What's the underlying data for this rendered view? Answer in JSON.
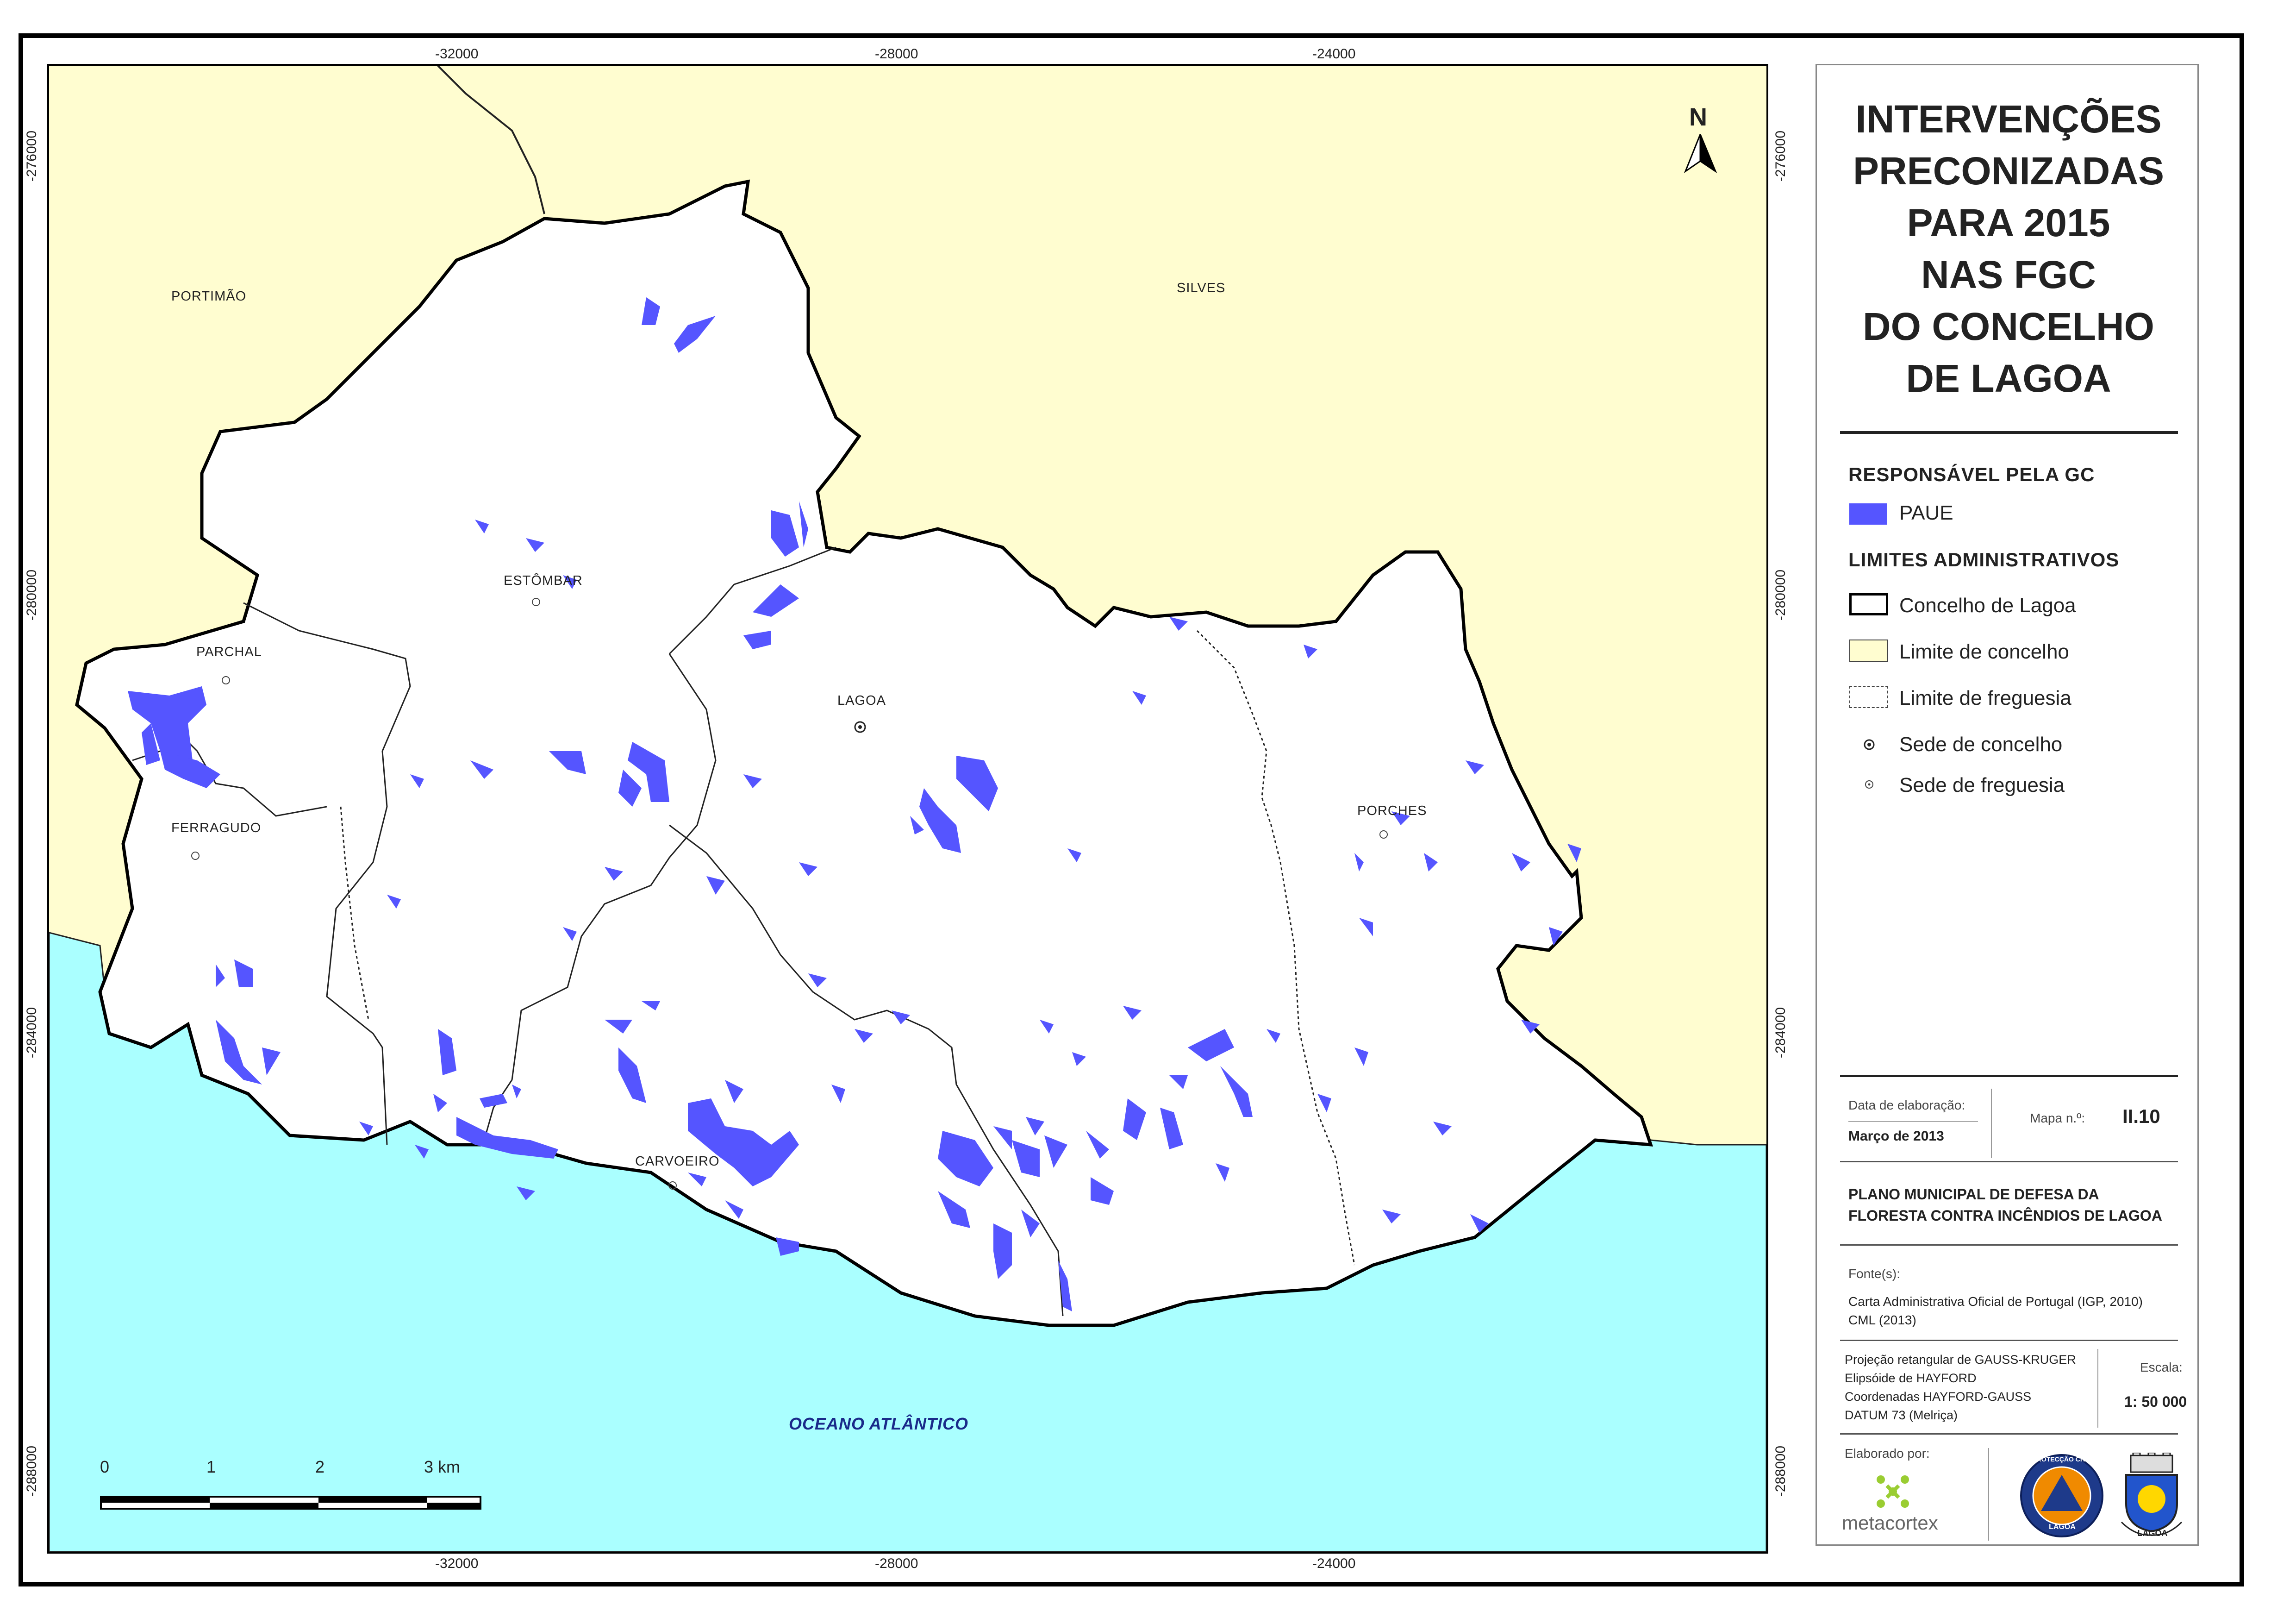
{
  "title_lines": [
    "INTERVENÇÕES",
    "PRECONIZADAS",
    "PARA 2015",
    "NAS FGC",
    "DO CONCELHO",
    "DE LAGOA"
  ],
  "coords": {
    "top": [
      "-32000",
      "-28000",
      "-24000"
    ],
    "bottom": [
      "-32000",
      "-28000",
      "-24000"
    ],
    "left": [
      "-276000",
      "-280000",
      "-284000",
      "-288000"
    ],
    "right": [
      "-276000",
      "-280000",
      "-284000",
      "-288000"
    ]
  },
  "places": {
    "portimao": "PORTIMÃO",
    "silves": "SILVES",
    "estombar": "ESTÔMBAR",
    "parchal": "PARCHAL",
    "ferragudo": "FERRAGUDO",
    "lagoa": "LAGOA",
    "porches": "PORCHES",
    "carvoeiro": "CARVOEIRO",
    "ocean": "OCEANO ATLÂNTICO"
  },
  "north_label": "N",
  "scale_bar": {
    "labels": [
      "0",
      "1",
      "2",
      "3 km"
    ]
  },
  "legend": {
    "responsible_heading": "RESPONSÁVEL PELA GC",
    "paue": "PAUE",
    "admin_heading": "LIMITES ADMINISTRATIVOS",
    "concelho_lagoa": "Concelho de Lagoa",
    "limite_concelho": "Limite de concelho",
    "limite_freguesia": "Limite de freguesia",
    "sede_concelho": "Sede de concelho",
    "sede_freguesia": "Sede de freguesia"
  },
  "info": {
    "date_label": "Data de elaboração:",
    "date_value": "Março de 2013",
    "map_no_label": "Mapa n.º:",
    "map_no_value": "II.10",
    "plan_line1": "PLANO MUNICIPAL DE DEFESA DA",
    "plan_line2": "FLORESTA CONTRA INCÊNDIOS DE LAGOA",
    "sources_label": "Fonte(s):",
    "source1": "Carta Administrativa Oficial de Portugal (IGP, 2010)",
    "source2": "CML (2013)",
    "proj1": "Projeção retangular de GAUSS-KRUGER",
    "proj2": "Elipsóide de HAYFORD",
    "proj3": "Coordenadas HAYFORD-GAUSS",
    "proj4": "DATUM 73 (Melriça)",
    "scale_label": "Escala:",
    "scale_value": "1: 50 000",
    "made_by": "Elaborado por:",
    "metacortex": "metacortex",
    "seal_text": "PROTECÇÃO CIVIL",
    "seal_lagoa": "LAGOA",
    "crest_lagoa": "LAGOA"
  },
  "colors": {
    "land_outside": "#fffdd0",
    "ocean": "#aaffff",
    "paue": "#5555ff",
    "concelho": "#ffffff"
  }
}
